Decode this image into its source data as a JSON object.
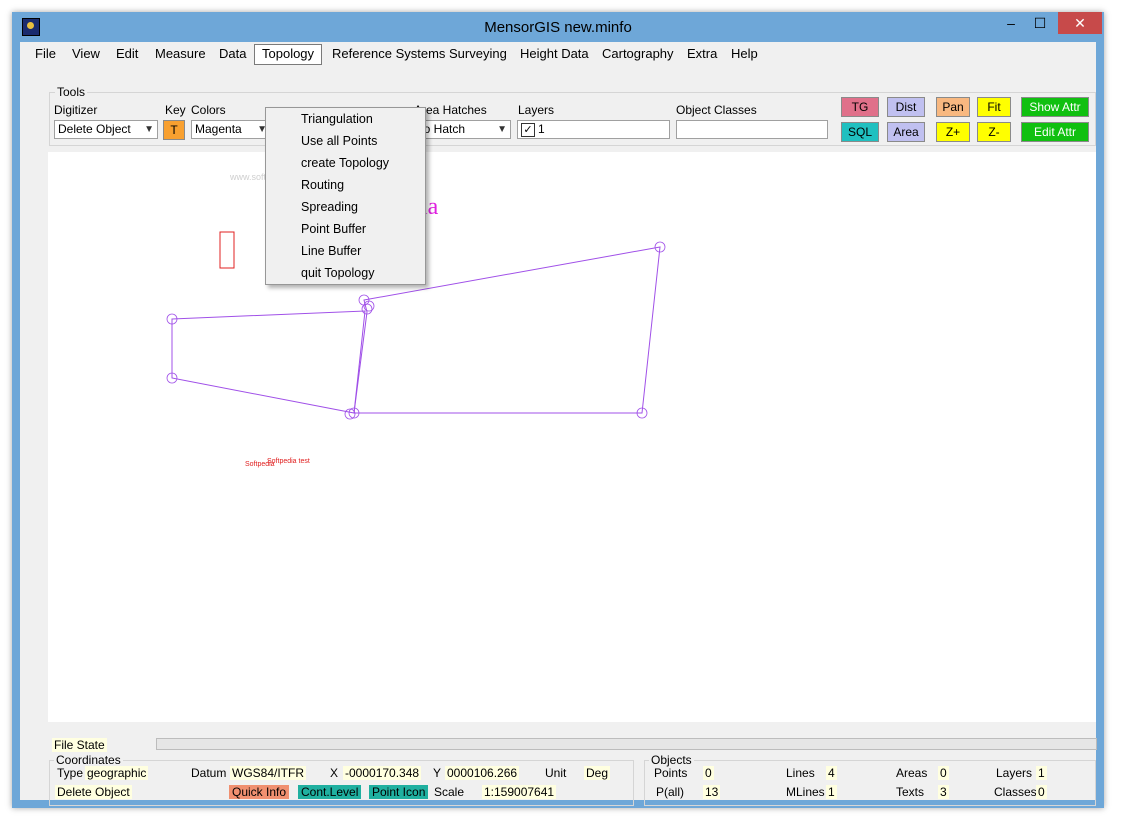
{
  "window": {
    "title": "MensorGIS new.minfo",
    "minimize_glyph": "–",
    "maximize_glyph": "☐",
    "close_glyph": "✕"
  },
  "menu": {
    "items": [
      "File",
      "View",
      "Edit",
      "Measure",
      "Data",
      "Topology",
      "Reference Systems",
      "Surveying",
      "Height Data",
      "Cartography",
      "Extra",
      "Help"
    ],
    "open_item": "Topology"
  },
  "topology_menu": [
    "Triangulation",
    "Use all Points",
    "create Topology",
    "Routing",
    "Spreading",
    "Point Buffer",
    "Line Buffer",
    "quit Topology"
  ],
  "tools": {
    "group_label": "Tools",
    "digitizer_label": "Digitizer",
    "digitizer_value": "Delete Object",
    "key_label": "Key",
    "key_value": "T",
    "colors_label": "Colors",
    "colors_value": "Magenta",
    "area_hatches_label": "Area Hatches",
    "area_hatches_value": "no Hatch",
    "layers_label": "Layers",
    "layers_value": "1",
    "layers_checked": "✓",
    "object_classes_label": "Object Classes",
    "object_classes_value": ""
  },
  "toolbar_buttons": {
    "tg": "TG",
    "sql": "SQL",
    "dist": "Dist",
    "area": "Area",
    "pan": "Pan",
    "zoom_in": "Z+",
    "fit": "Fit",
    "zoom_out": "Z-",
    "show_attr": "Show Attr",
    "edit_attr": "Edit Attr"
  },
  "canvas": {
    "label_partial": "dia",
    "text_softpedia": "Softpedia",
    "text_softpedia_test": "Softpedia test",
    "watermark": "www.softpedia.com"
  },
  "file_state": {
    "label": "File State"
  },
  "coordinates": {
    "group_label": "Coordinates",
    "type_label": "Type",
    "type_value": "geographic",
    "datum_label": "Datum",
    "datum_value": "WGS84/ITFR",
    "x_label": "X",
    "x_value": "-0000170.348",
    "y_label": "Y",
    "y_value": "0000106.266",
    "unit_label": "Unit",
    "unit_value": "Deg",
    "mode_value": "Delete Object",
    "quick_info": "Quick Info",
    "cont_level": "Cont.Level",
    "point_icon": "Point Icon",
    "scale_label": "Scale",
    "scale_value": "1:159007641"
  },
  "objects": {
    "group_label": "Objects",
    "points_label": "Points",
    "points_value": "0",
    "pall_label": "P(all)",
    "pall_value": "13",
    "lines_label": "Lines",
    "lines_value": "4",
    "mlines_label": "MLines",
    "mlines_value": "1",
    "areas_label": "Areas",
    "areas_value": "0",
    "texts_label": "Texts",
    "texts_value": "3",
    "layers_label": "Layers",
    "layers_value": "1",
    "classes_label": "Classes",
    "classes_value": "0"
  },
  "colors": {
    "title_bar": "#6ea7d8",
    "tg_button": "#e0708a",
    "sql_button": "#20c0c0",
    "dist_area_button": "#c0c0f0",
    "pan_button": "#f8b880",
    "zoom_button": "#ffff00",
    "attr_button": "#10c010",
    "polygon_stroke": "#a050e8",
    "text_magenta": "#e020e0",
    "quick_info": "#f09070",
    "teal_label": "#20b0a0"
  }
}
